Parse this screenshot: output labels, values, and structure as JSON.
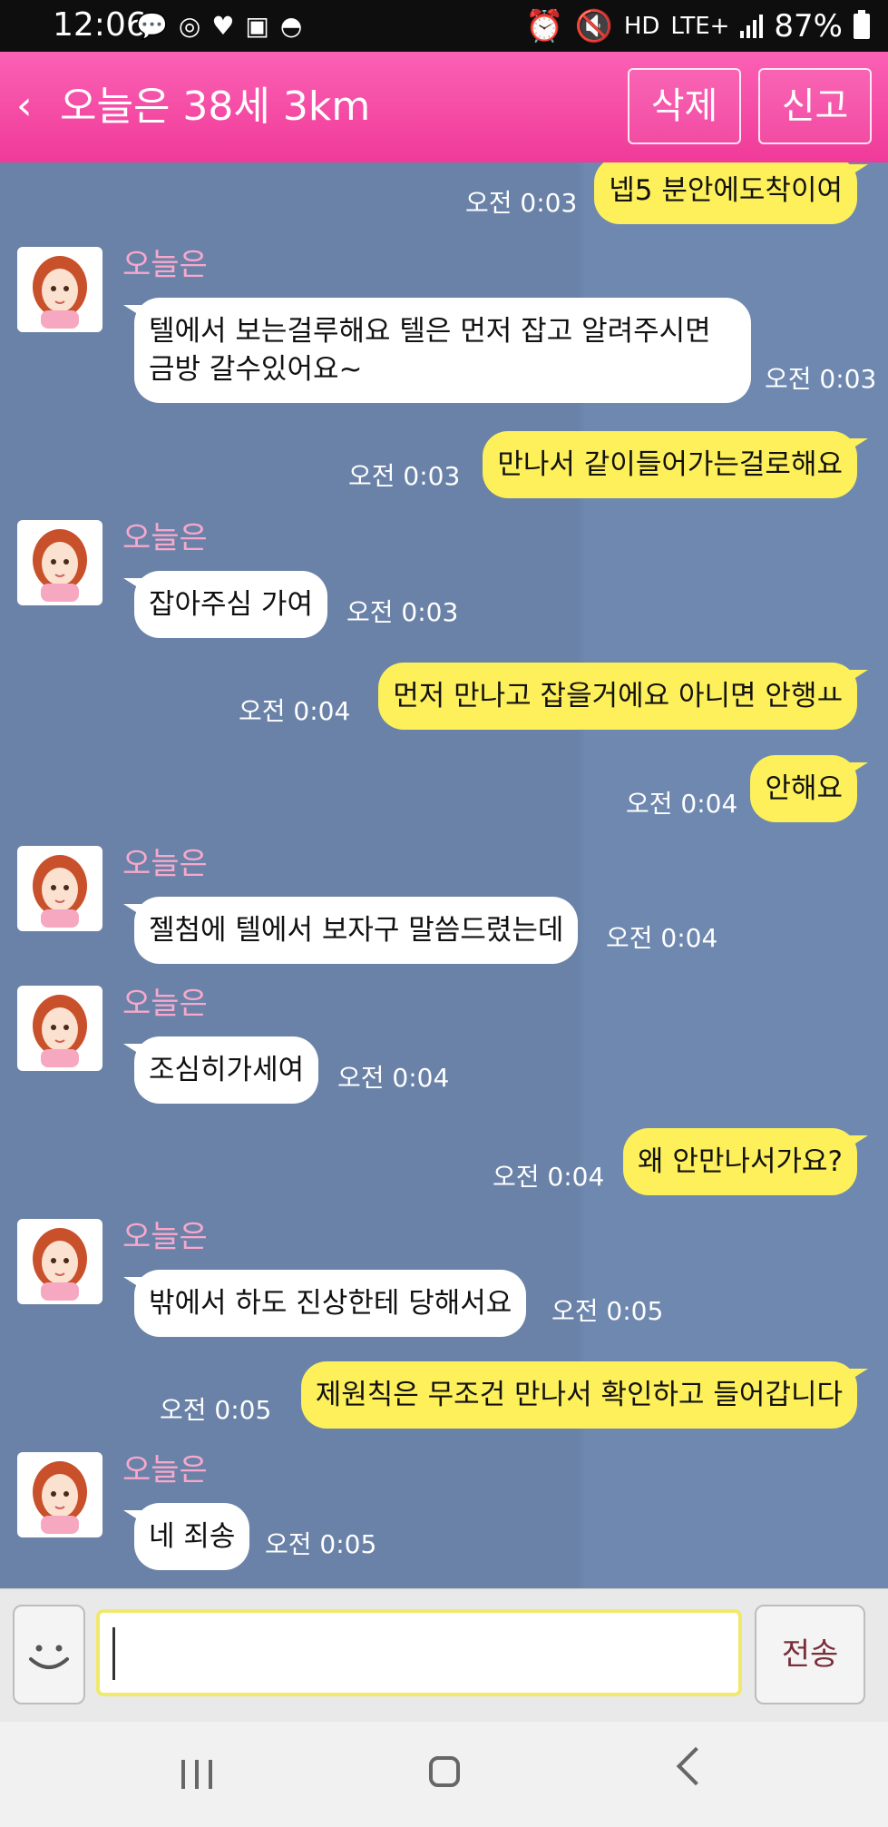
{
  "status_bar": {
    "time": "12:06",
    "left_icons": [
      "talk-icon",
      "instagram-icon",
      "heart-icon",
      "image-icon",
      "incognito-icon"
    ],
    "network": "LTE+",
    "hd": "HD",
    "battery": "87%"
  },
  "header": {
    "title": "오늘은 38세 3km",
    "delete_label": "삭제",
    "report_label": "신고",
    "accent_color": "#f33f9c"
  },
  "messages": [
    {
      "side": "mine",
      "text": "넵5 분안에도착이여",
      "time": "오전 0:03"
    },
    {
      "side": "theirs",
      "sender": "오늘은",
      "lines": [
        "텔에서 보는걸루해요 텔은 먼저 잡고 알려주시면",
        "금방 갈수있어요~"
      ],
      "time": "오전 0:03"
    },
    {
      "side": "mine",
      "text": "만나서 같이들어가는걸로해요",
      "time": "오전 0:03"
    },
    {
      "side": "theirs",
      "sender": "오늘은",
      "text": "잡아주심 가여",
      "time": "오전 0:03"
    },
    {
      "side": "mine",
      "text": "먼저 만나고 잡을거에요 아니면 안행ㅛ",
      "time": "오전 0:04"
    },
    {
      "side": "mine",
      "text": "안해요",
      "time": "오전 0:04"
    },
    {
      "side": "theirs",
      "sender": "오늘은",
      "text": "젤첨에 텔에서 보자구 말씀드렸는데",
      "time": "오전 0:04"
    },
    {
      "side": "theirs",
      "sender": "오늘은",
      "text": "조심히가세여",
      "time": "오전 0:04"
    },
    {
      "side": "mine",
      "text": "왜 안만나서가요?",
      "time": "오전 0:04"
    },
    {
      "side": "theirs",
      "sender": "오늘은",
      "text": "밖에서 하도 진상한테 당해서요",
      "time": "오전 0:05"
    },
    {
      "side": "mine",
      "text": "제원칙은 무조건 만나서 확인하고 들어갑니다",
      "time": "오전 0:05"
    },
    {
      "side": "theirs",
      "sender": "오늘은",
      "text": "네 죄송",
      "time": "오전 0:05"
    }
  ],
  "input": {
    "value": "",
    "send_label": "전송"
  },
  "colors": {
    "chat_bg": "#6a82a7",
    "my_bubble": "#fdf05a",
    "their_bubble": "#ffffff",
    "sender_name": "#f7a8cc"
  }
}
